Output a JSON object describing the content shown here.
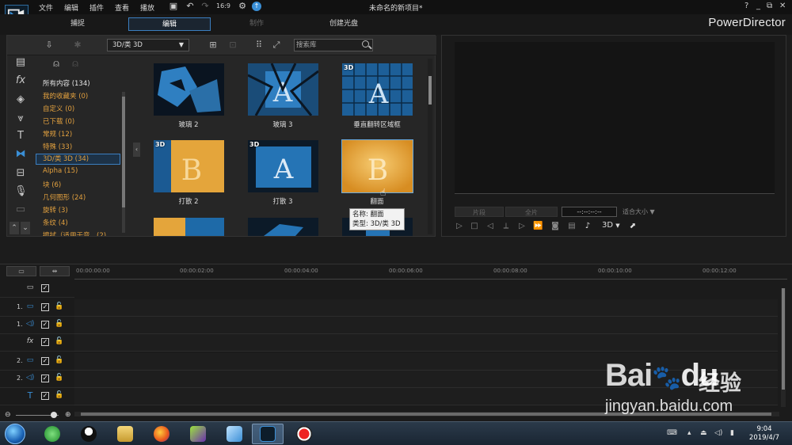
{
  "app": {
    "title": "未命名的新项目*",
    "brand": "PowerDirector",
    "menus": [
      "文件",
      "编辑",
      "插件",
      "查看",
      "播放"
    ]
  },
  "modes": {
    "capture": "捕捉",
    "edit": "编辑",
    "produce": "制作",
    "disc": "创建光盘"
  },
  "library": {
    "category_select": "3D/类 3D",
    "search_placeholder": "搜索库",
    "categories": [
      "所有内容 (134)",
      "我的收藏夹 (0)",
      "自定义 (0)",
      "已下载 (0)",
      "常规 (12)",
      "特殊 (33)",
      "3D/类 3D (34)",
      "Alpha (15)",
      "块 (6)",
      "几何图形 (24)",
      "旋转 (3)",
      "条纹 (4)",
      "擦拭（适用于音…(2)"
    ],
    "items": [
      {
        "label": "玻璃 2",
        "badge": ""
      },
      {
        "label": "玻璃 3",
        "badge": ""
      },
      {
        "label": "垂直翻转区域框",
        "badge": "3D"
      },
      {
        "label": "打散 2",
        "badge": "3D"
      },
      {
        "label": "打散 3",
        "badge": "3D"
      },
      {
        "label": "翻面",
        "badge": ""
      }
    ],
    "tooltip": {
      "name": "名称: 翻面",
      "type": "类型: 3D/类 3D"
    }
  },
  "preview": {
    "clip_btn": "片段",
    "movie_btn": "全片",
    "timecode": "--:--:--:--",
    "fit": "适合大小",
    "mode3d": "3D"
  },
  "timeline": {
    "ticks": [
      "00:00:00:00",
      "00:00:02:00",
      "00:00:04:00",
      "00:00:06:00",
      "00:00:08:00",
      "00:00:10:00",
      "00:00:12:00"
    ],
    "tracks": [
      {
        "num": "",
        "icon": "track-all-icon"
      },
      {
        "num": "1.",
        "icon": "video-track-icon"
      },
      {
        "num": "1.",
        "icon": "audio-track-icon"
      },
      {
        "num": "",
        "icon": "fx-track-icon"
      },
      {
        "num": "2.",
        "icon": "video-track-icon"
      },
      {
        "num": "2.",
        "icon": "audio-track-icon"
      },
      {
        "num": "",
        "icon": "title-track-icon"
      }
    ]
  },
  "taskbar": {
    "time": "9:04",
    "date": "2019/4/7"
  },
  "watermark": {
    "logo": "Bai",
    "logo2": "du",
    "cn": "经验",
    "url": "jingyan.baidu.com"
  }
}
